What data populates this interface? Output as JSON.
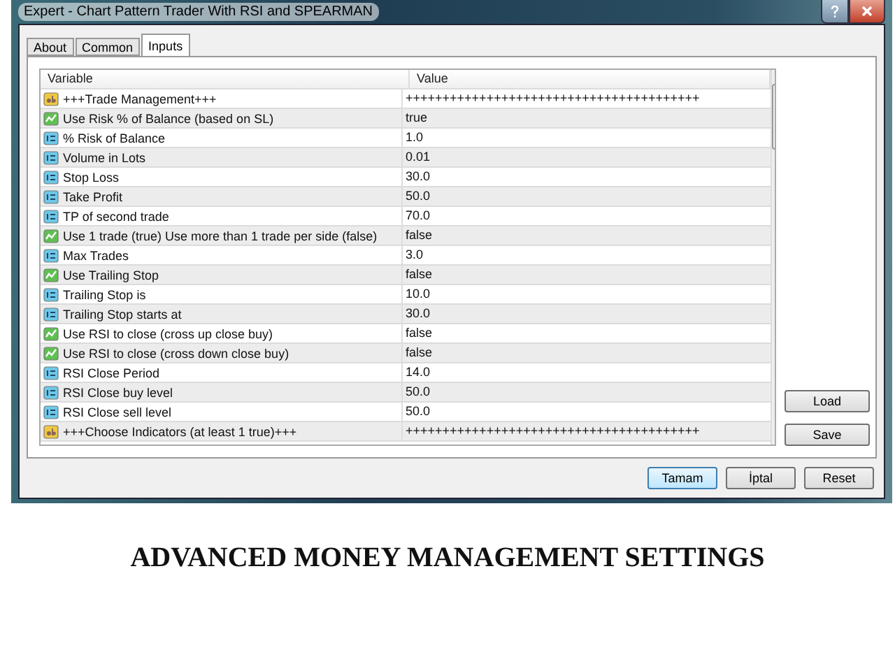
{
  "window": {
    "title": "Expert - Chart Pattern Trader With RSI and SPEARMAN"
  },
  "tabs": [
    {
      "label": "About",
      "selected": false
    },
    {
      "label": "Common",
      "selected": false
    },
    {
      "label": "Inputs",
      "selected": true
    }
  ],
  "table": {
    "columns": [
      "Variable",
      "Value"
    ],
    "rows": [
      {
        "kind": "text",
        "variable": "+++Trade Management+++",
        "value": "++++++++++++++++++++++++++++++++++++++++"
      },
      {
        "kind": "bool",
        "variable": "Use Risk % of Balance (based on SL)",
        "value": "true"
      },
      {
        "kind": "number",
        "variable": "% Risk of Balance",
        "value": "1.0"
      },
      {
        "kind": "number",
        "variable": "Volume in Lots",
        "value": "0.01"
      },
      {
        "kind": "number",
        "variable": "Stop Loss",
        "value": "30.0"
      },
      {
        "kind": "number",
        "variable": "Take Profit",
        "value": "50.0"
      },
      {
        "kind": "number",
        "variable": "TP of second trade",
        "value": "70.0"
      },
      {
        "kind": "bool",
        "variable": "Use 1 trade (true) Use more than 1 trade per side (false)",
        "value": "false"
      },
      {
        "kind": "number",
        "variable": "Max Trades",
        "value": "3.0"
      },
      {
        "kind": "bool",
        "variable": "Use Trailing Stop",
        "value": "false"
      },
      {
        "kind": "number",
        "variable": "Trailing Stop is",
        "value": "10.0"
      },
      {
        "kind": "number",
        "variable": "Trailing Stop starts at",
        "value": "30.0"
      },
      {
        "kind": "bool",
        "variable": "Use RSI to close (cross up close buy)",
        "value": "false"
      },
      {
        "kind": "bool",
        "variable": "Use RSI to close (cross down close buy)",
        "value": "false"
      },
      {
        "kind": "number",
        "variable": "RSI Close Period",
        "value": "14.0"
      },
      {
        "kind": "number",
        "variable": "RSI Close buy level",
        "value": "50.0"
      },
      {
        "kind": "number",
        "variable": "RSI Close sell level",
        "value": "50.0"
      },
      {
        "kind": "text",
        "variable": "+++Choose Indicators (at least 1 true)+++",
        "value": "++++++++++++++++++++++++++++++++++++++++"
      }
    ]
  },
  "side_buttons": [
    "Load",
    "Save"
  ],
  "buttons": [
    {
      "label": "Tamam",
      "selected": true
    },
    {
      "label": "İptal",
      "selected": false
    },
    {
      "label": "Reset",
      "selected": false
    }
  ],
  "caption": "ADVANCED MONEY MANAGEMENT SETTINGS"
}
